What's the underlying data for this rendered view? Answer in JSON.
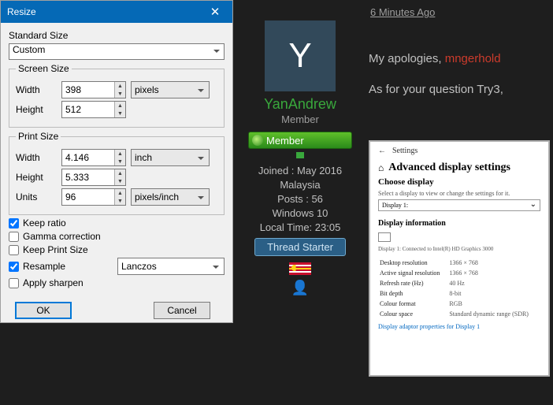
{
  "dialog": {
    "title": "Resize",
    "standard_size_label": "Standard Size",
    "standard_size_value": "Custom",
    "screen_group": "Screen Size",
    "width_label": "Width",
    "height_label": "Height",
    "screen_width": "398",
    "screen_height": "512",
    "screen_unit": "pixels",
    "print_group": "Print Size",
    "print_width": "4.146",
    "print_height": "5.333",
    "print_unit": "inch",
    "units_label": "Units",
    "units_value": "96",
    "units_unit": "pixels/inch",
    "keep_ratio": "Keep ratio",
    "gamma": "Gamma correction",
    "keep_print": "Keep Print Size",
    "resample": "Resample",
    "resample_method": "Lanczos",
    "sharpen": "Apply sharpen",
    "ok": "OK",
    "cancel": "Cancel"
  },
  "forum": {
    "timestamp": "6 Minutes Ago",
    "username": "YanAndrew",
    "avatar_letter": "Y",
    "role": "Member",
    "member_badge": "Member",
    "joined": "Joined : May 2016",
    "country": "Malaysia",
    "posts": "Posts : 56",
    "os": "Windows 10",
    "localtime": "Local Time: 23:05",
    "thread_starter": "Thread Starter",
    "line1a": "My apologies, ",
    "line1b": "mngerhold",
    "line2": "As for your question Try3,"
  },
  "embed": {
    "nav": "Settings",
    "title": "Advanced display settings",
    "choose": "Choose display",
    "hint": "Select a display to view or change the settings for it.",
    "display_sel": "Display 1:",
    "info_title": "Display information",
    "conn": "Display 1: Connected to Intel(R) HD Graphics 3000",
    "rows": [
      [
        "Desktop resolution",
        "1366 × 768"
      ],
      [
        "Active signal resolution",
        "1366 × 768"
      ],
      [
        "Refresh rate (Hz)",
        "40 Hz"
      ],
      [
        "Bit depth",
        "8-bit"
      ],
      [
        "Colour format",
        "RGB"
      ],
      [
        "Colour space",
        "Standard dynamic range (SDR)"
      ]
    ],
    "link": "Display adaptor properties for Display 1"
  }
}
